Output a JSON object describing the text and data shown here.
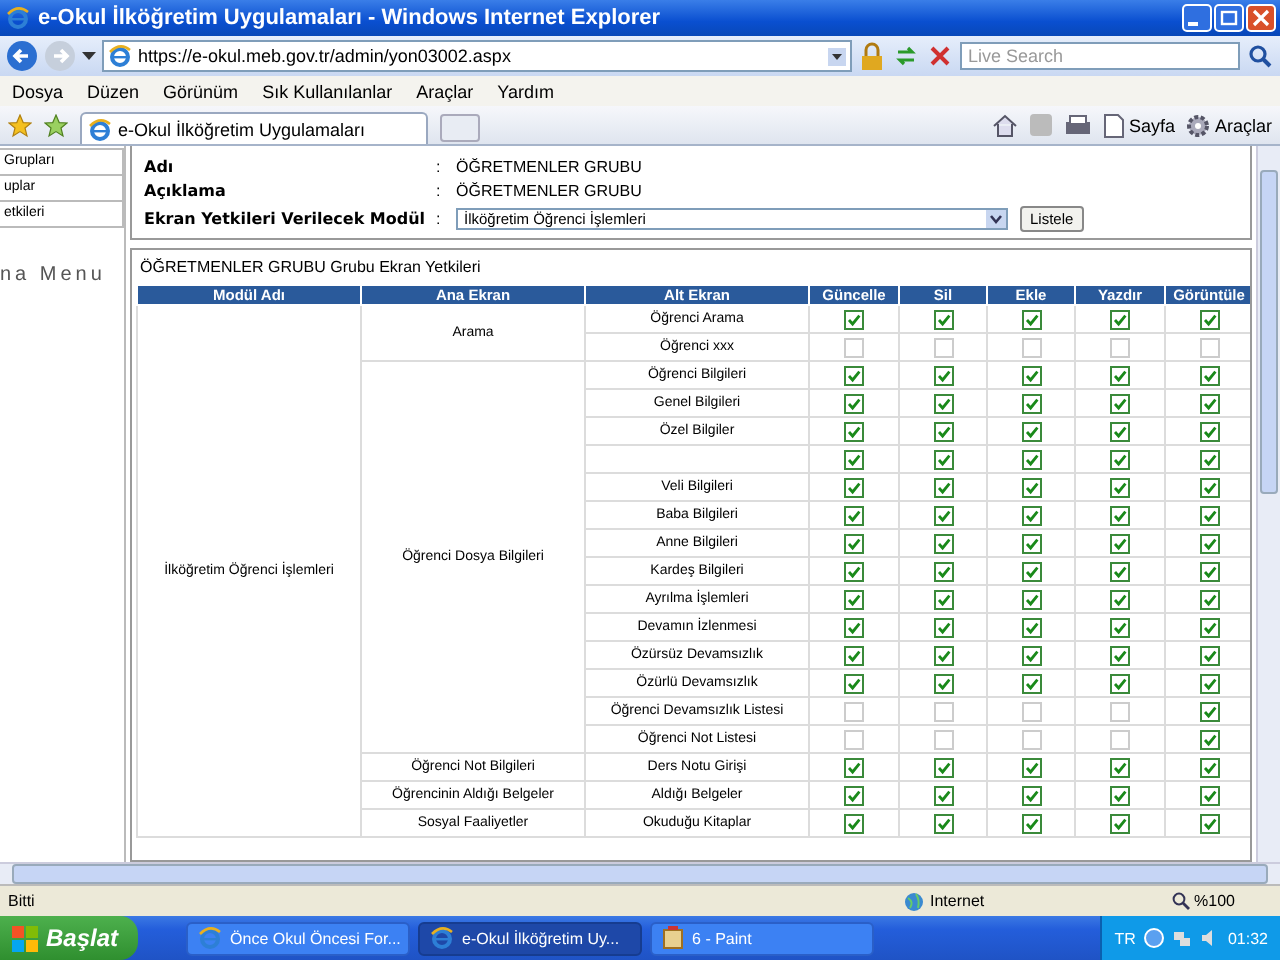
{
  "window": {
    "title": "e-Okul İlköğretim Uygulamaları - Windows Internet Explorer"
  },
  "address_bar": {
    "url": "https://e-okul.meb.gov.tr/admin/yon03002.aspx",
    "search_placeholder": "Live Search"
  },
  "menu": [
    "Dosya",
    "Düzen",
    "Görünüm",
    "Sık Kullanılanlar",
    "Araçlar",
    "Yardım"
  ],
  "tab": {
    "label": "e-Okul İlköğretim Uygulamaları"
  },
  "command_bar": {
    "page": "Sayfa",
    "tools": "Araçlar"
  },
  "sidebar": {
    "items": [
      "Grupları",
      "uplar",
      "etkileri"
    ],
    "heading": "na Menu"
  },
  "group_info": {
    "separator": ":",
    "fields": [
      {
        "label": "Adı",
        "value": "ÖĞRETMENLER GRUBU"
      },
      {
        "label": "Açıklama",
        "value": "ÖĞRETMENLER GRUBU"
      }
    ],
    "module_label": "Ekran Yetkileri Verilecek Modül",
    "module_value": "İlköğretim Öğrenci İşlemleri",
    "list_button": "Listele"
  },
  "table": {
    "title": "ÖĞRETMENLER GRUBU  Grubu Ekran Yetkileri",
    "columns": [
      "Modül Adı",
      "Ana Ekran",
      "Alt Ekran",
      "Güncelle",
      "Sil",
      "Ekle",
      "Yazdır",
      "Görüntüle"
    ],
    "module": "İlköğretim Öğrenci İşlemleri",
    "groups": [
      {
        "main": "Arama",
        "rows": [
          {
            "sub": "Öğrenci Arama",
            "perms": [
              true,
              true,
              true,
              true,
              true
            ]
          },
          {
            "sub": "Öğrenci xxx",
            "perms": [
              false,
              false,
              false,
              false,
              false
            ]
          }
        ]
      },
      {
        "main": "Öğrenci Dosya Bilgileri",
        "rows": [
          {
            "sub": "Öğrenci Bilgileri",
            "perms": [
              true,
              true,
              true,
              true,
              true
            ]
          },
          {
            "sub": "Genel Bilgileri",
            "perms": [
              true,
              true,
              true,
              true,
              true
            ]
          },
          {
            "sub": "Özel Bilgiler",
            "perms": [
              true,
              true,
              true,
              true,
              true
            ]
          },
          {
            "perms": [
              true,
              true,
              true,
              true,
              true
            ]
          },
          {
            "sub": "Veli Bilgileri",
            "perms": [
              true,
              true,
              true,
              true,
              true
            ]
          },
          {
            "sub": "Baba Bilgileri",
            "perms": [
              true,
              true,
              true,
              true,
              true
            ]
          },
          {
            "sub": "Anne Bilgileri",
            "perms": [
              true,
              true,
              true,
              true,
              true
            ]
          },
          {
            "sub": "Kardeş Bilgileri",
            "perms": [
              true,
              true,
              true,
              true,
              true
            ]
          },
          {
            "sub": "Ayrılma İşlemleri",
            "perms": [
              true,
              true,
              true,
              true,
              true
            ]
          },
          {
            "sub": "Devamın İzlenmesi",
            "perms": [
              true,
              true,
              true,
              true,
              true
            ]
          },
          {
            "sub": "Özürsüz Devamsızlık",
            "perms": [
              true,
              true,
              true,
              true,
              true
            ]
          },
          {
            "sub": "Özürlü Devamsızlık",
            "perms": [
              true,
              true,
              true,
              true,
              true
            ]
          },
          {
            "sub": "Öğrenci Devamsızlık Listesi",
            "perms": [
              false,
              false,
              false,
              false,
              true
            ]
          },
          {
            "sub": "Öğrenci Not Listesi",
            "perms": [
              false,
              false,
              false,
              false,
              true
            ]
          }
        ]
      },
      {
        "main": "Öğrenci Not Bilgileri",
        "rows": [
          {
            "sub": "Ders Notu Girişi",
            "perms": [
              true,
              true,
              true,
              true,
              true
            ]
          }
        ]
      },
      {
        "main": "Öğrencinin Aldığı Belgeler",
        "rows": [
          {
            "sub": "Aldığı Belgeler",
            "perms": [
              true,
              true,
              true,
              true,
              true
            ]
          }
        ]
      },
      {
        "main": "Sosyal Faaliyetler",
        "rows": [
          {
            "sub": "Okuduğu Kitaplar",
            "perms": [
              true,
              true,
              true,
              true,
              true
            ]
          }
        ]
      }
    ]
  },
  "status_bar": {
    "text": "Bitti",
    "zone": "Internet",
    "zoom": "%100"
  },
  "taskbar": {
    "start": "Başlat",
    "items": [
      {
        "label": "Önce Okul Öncesi For...",
        "kind": "browser",
        "selected": false
      },
      {
        "label": "e-Okul İlköğretim Uy...",
        "kind": "browser",
        "selected": true
      },
      {
        "label": "6 - Paint",
        "kind": "paint",
        "selected": false
      }
    ],
    "language": "TR",
    "clock": "01:32"
  }
}
